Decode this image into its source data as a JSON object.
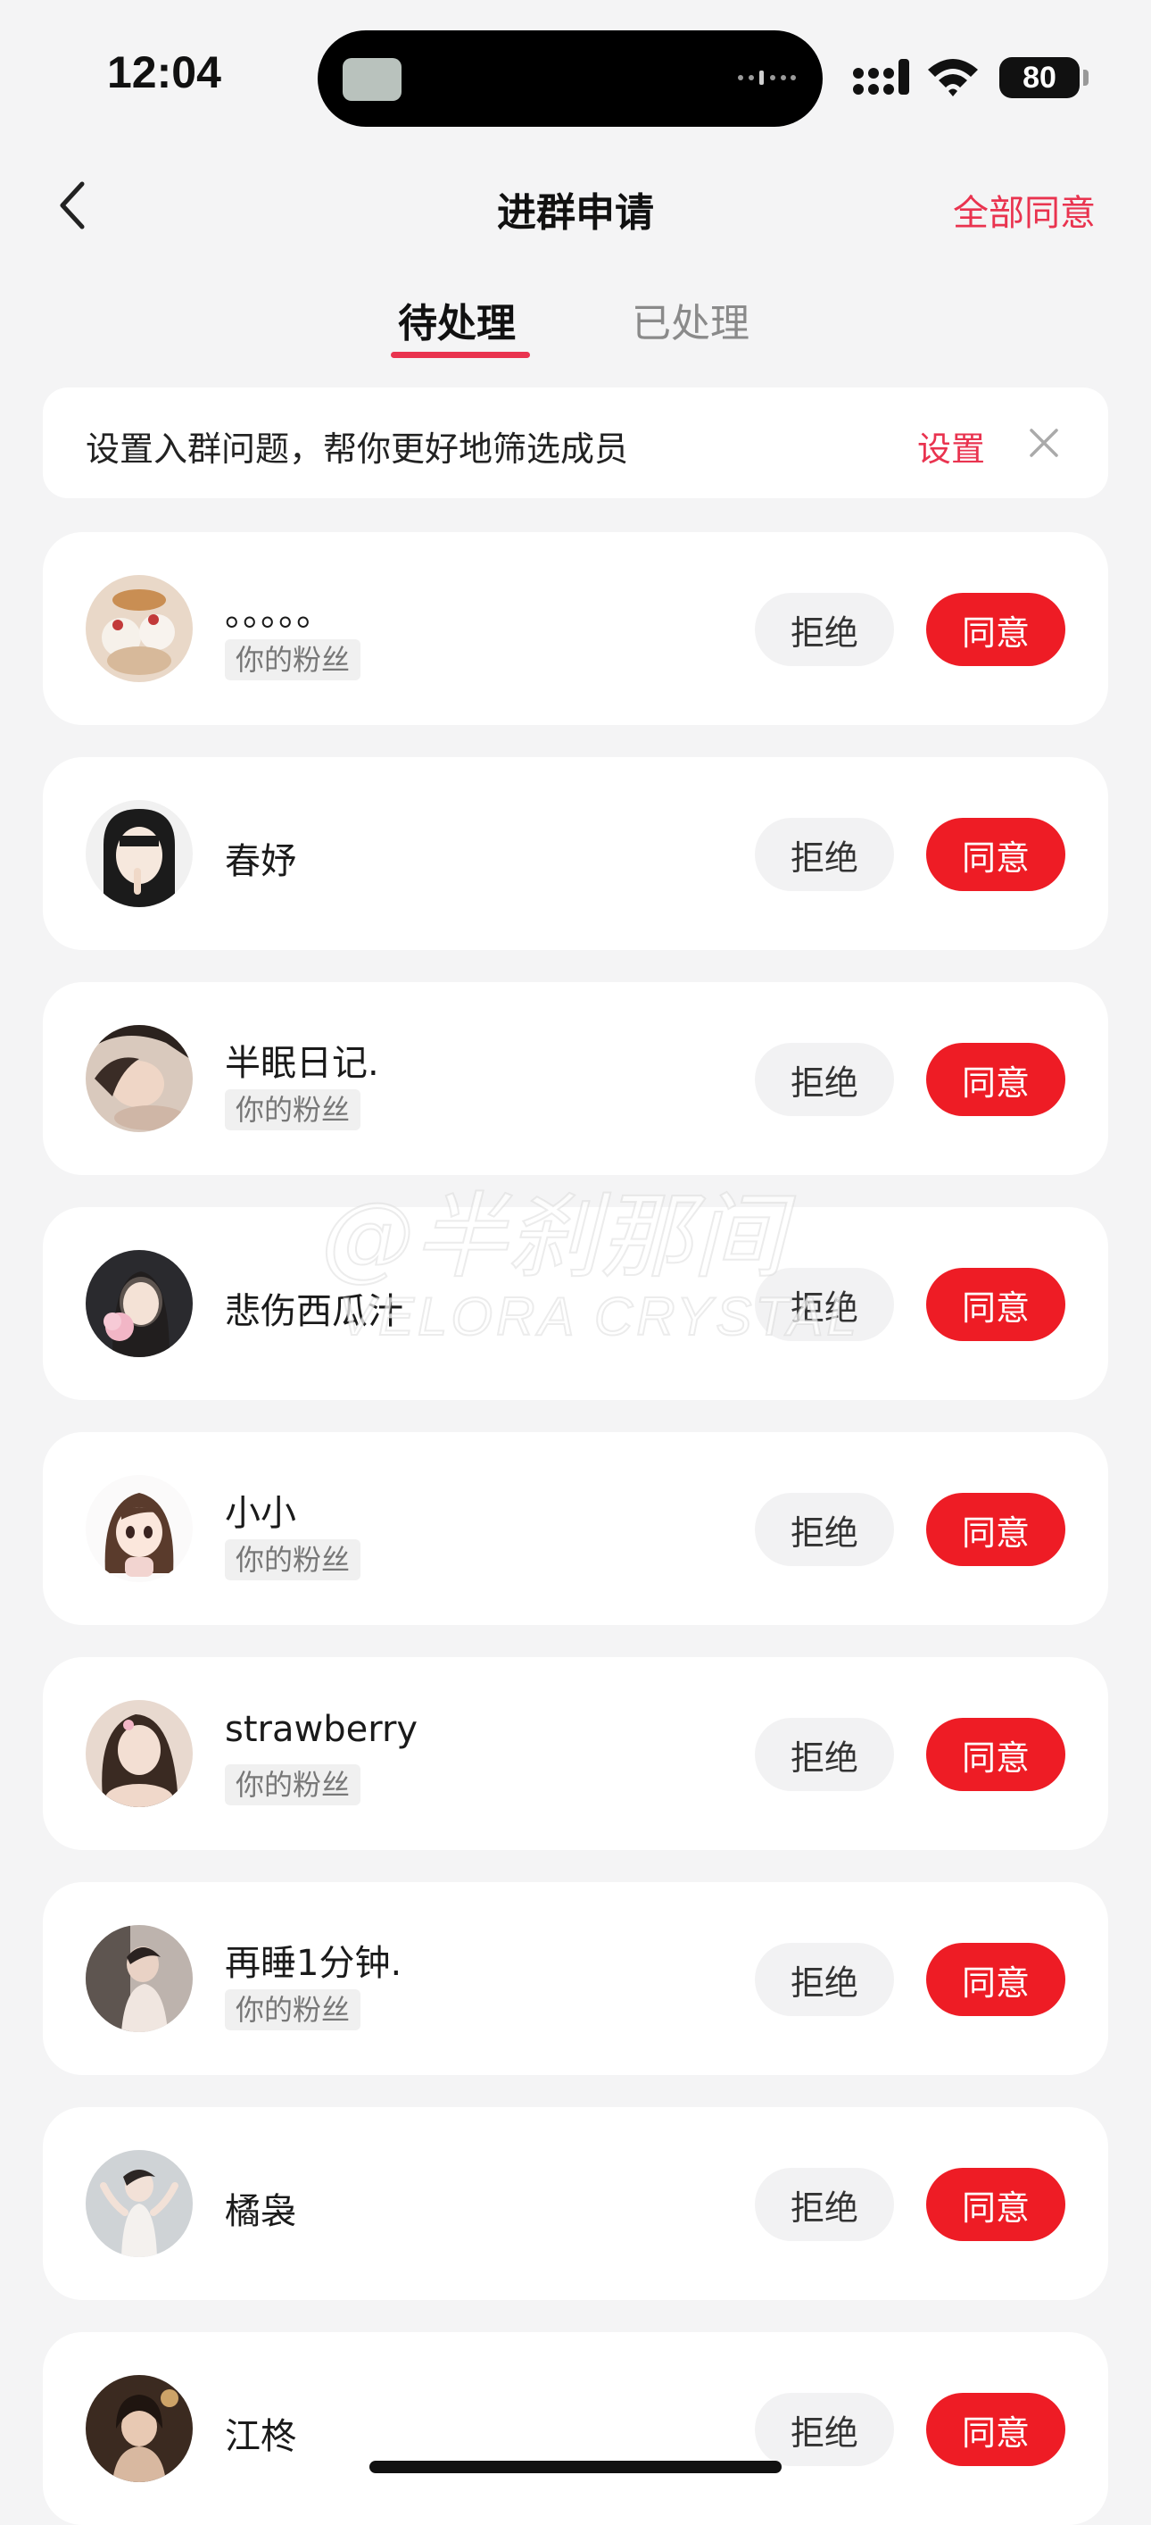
{
  "status_bar": {
    "time": "12:04",
    "battery": "80"
  },
  "nav": {
    "title": "进群申请",
    "accept_all": "全部同意"
  },
  "tabs": {
    "pending": "待处理",
    "processed": "已处理"
  },
  "tip": {
    "text": "设置入群问题，帮你更好地筛选成员",
    "action": "设置"
  },
  "buttons": {
    "reject": "拒绝",
    "agree": "同意"
  },
  "requests": [
    {
      "name": "。。。。。",
      "tag": "你的粉丝"
    },
    {
      "name": "春妤",
      "tag": ""
    },
    {
      "name": "半眠日记.",
      "tag": "你的粉丝"
    },
    {
      "name": "悲伤西瓜汁",
      "tag": ""
    },
    {
      "name": "小小",
      "tag": "你的粉丝"
    },
    {
      "name": "strawberry",
      "tag": "你的粉丝"
    },
    {
      "name": "再睡1分钟.",
      "tag": "你的粉丝"
    },
    {
      "name": "橘袅",
      "tag": ""
    },
    {
      "name": "江柊",
      "tag": ""
    }
  ],
  "watermark": {
    "line1": "@半刹那间",
    "line2": "VELORA CRYSTAL"
  }
}
